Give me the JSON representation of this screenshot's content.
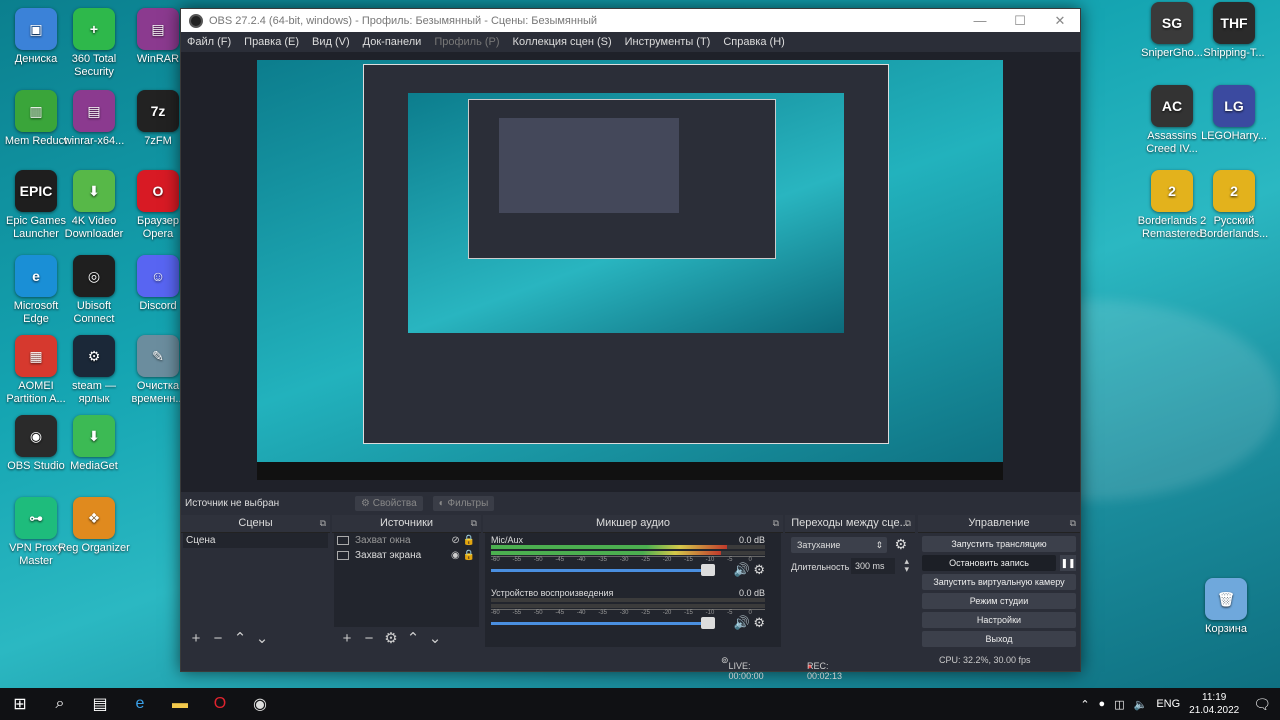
{
  "desktop": {
    "icons": [
      {
        "label": "Дениска",
        "icon": "folder-icon",
        "color": "#3b82d8",
        "glyph": "▣"
      },
      {
        "label": "360 Total Security",
        "icon": "security-icon",
        "color": "#2eb84b",
        "glyph": "+"
      },
      {
        "label": "WinRAR",
        "icon": "archive-icon",
        "color": "#8b3a8f",
        "glyph": "▤"
      },
      {
        "label": "Mem Reduct",
        "icon": "memory-icon",
        "color": "#3aa53a",
        "glyph": "▥"
      },
      {
        "label": "winrar-x64...",
        "icon": "archive-icon",
        "color": "#8b3a8f",
        "glyph": "▤"
      },
      {
        "label": "7zFM",
        "icon": "7zip-icon",
        "color": "#222222",
        "glyph": "7z"
      },
      {
        "label": "Epic Games Launcher",
        "icon": "epic-games-icon",
        "color": "#1e1e1e",
        "glyph": "EPIC"
      },
      {
        "label": "4K Video Downloader",
        "icon": "video-downloader-icon",
        "color": "#57b848",
        "glyph": "⬇"
      },
      {
        "label": "Браузер Opera",
        "icon": "opera-icon",
        "color": "#d81a24",
        "glyph": "O"
      },
      {
        "label": "Microsoft Edge",
        "icon": "edge-icon",
        "color": "#1a8fd6",
        "glyph": "e"
      },
      {
        "label": "Ubisoft Connect",
        "icon": "ubisoft-icon",
        "color": "#1f1f1f",
        "glyph": "◎"
      },
      {
        "label": "Discord",
        "icon": "discord-icon",
        "color": "#5865f2",
        "glyph": "☺"
      },
      {
        "label": "AOMEI Partition A...",
        "icon": "partition-icon",
        "color": "#d6392e",
        "glyph": "▦"
      },
      {
        "label": "steam — ярлык",
        "icon": "steam-icon",
        "color": "#1b2838",
        "glyph": "⚙"
      },
      {
        "label": "Очистка временн...",
        "icon": "broom-icon",
        "color": "#6b8d9e",
        "glyph": "✎"
      },
      {
        "label": "OBS Studio",
        "icon": "obs-icon",
        "color": "#2a2a2a",
        "glyph": "◉"
      },
      {
        "label": "MediaGet",
        "icon": "mediaget-icon",
        "color": "#3cba54",
        "glyph": "⬇"
      },
      {
        "label": "VPN Proxy Master",
        "icon": "vpn-icon",
        "color": "#1ebc7c",
        "glyph": "⊶"
      },
      {
        "label": "Reg Organizer",
        "icon": "reg-organizer-icon",
        "color": "#e08a1e",
        "glyph": "❖"
      },
      {
        "label": "SniperGho...",
        "icon": "game-icon",
        "color": "#3a3a3a",
        "glyph": "SG"
      },
      {
        "label": "Shipping-T...",
        "icon": "game-icon",
        "color": "#2b2b2b",
        "glyph": "THF"
      },
      {
        "label": "Assassins Creed IV...",
        "icon": "game-icon",
        "color": "#333333",
        "glyph": "AC"
      },
      {
        "label": "LEGOHarry...",
        "icon": "game-icon",
        "color": "#3b4aa0",
        "glyph": "LG"
      },
      {
        "label": "Borderlands 2 Remastered",
        "icon": "game-icon",
        "color": "#e3b21c",
        "glyph": "2"
      },
      {
        "label": "Русский Borderlands...",
        "icon": "game-icon",
        "color": "#e3b21c",
        "glyph": "2"
      },
      {
        "label": "Корзина",
        "icon": "recycle-bin-icon",
        "color": "#6fa8dc",
        "glyph": "🗑"
      }
    ]
  },
  "obs": {
    "title": "OBS 27.2.4 (64-bit, windows) - Профиль: Безымянный - Сцены: Безымянный",
    "menu": [
      {
        "label": "Файл (F)",
        "disabled": false
      },
      {
        "label": "Правка (E)",
        "disabled": false
      },
      {
        "label": "Вид (V)",
        "disabled": false
      },
      {
        "label": "Док-панели",
        "disabled": false
      },
      {
        "label": "Профиль (P)",
        "disabled": true
      },
      {
        "label": "Коллекция сцен (S)",
        "disabled": false
      },
      {
        "label": "Инструменты (T)",
        "disabled": false
      },
      {
        "label": "Справка (H)",
        "disabled": false
      }
    ],
    "source_bar": {
      "label": "Источник не выбран",
      "properties": "Свойства",
      "filters": "Фильтры"
    },
    "scenes": {
      "title": "Сцены",
      "items": [
        "Сцена"
      ]
    },
    "sources": {
      "title": "Источники",
      "items": [
        "Захват окна",
        "Захват экрана"
      ]
    },
    "mixer": {
      "title": "Микшер аудио",
      "channels": [
        {
          "name": "Mic/Aux",
          "db": "0.0 dB"
        },
        {
          "name": "Устройство воспроизведения",
          "db": "0.0 dB"
        }
      ],
      "ticks": [
        "-60",
        "-55",
        "-50",
        "-45",
        "-40",
        "-35",
        "-30",
        "-25",
        "-20",
        "-15",
        "-10",
        "-5",
        "0"
      ]
    },
    "transitions": {
      "title": "Переходы между сце...",
      "type": "Затухание",
      "duration_label": "Длительность",
      "duration_value": "300 ms"
    },
    "controls": {
      "title": "Управление",
      "buttons": [
        "Запустить трансляцию",
        "Остановить запись",
        "Запустить виртуальную камеру",
        "Режим студии",
        "Настройки",
        "Выход"
      ]
    },
    "status": {
      "live": "LIVE: 00:00:00",
      "rec": "REC: 00:02:13",
      "cpu": "CPU: 32.2%, 30.00 fps"
    }
  },
  "taskbar": {
    "lang": "ENG",
    "time": "11:19",
    "date": "21.04.2022"
  }
}
